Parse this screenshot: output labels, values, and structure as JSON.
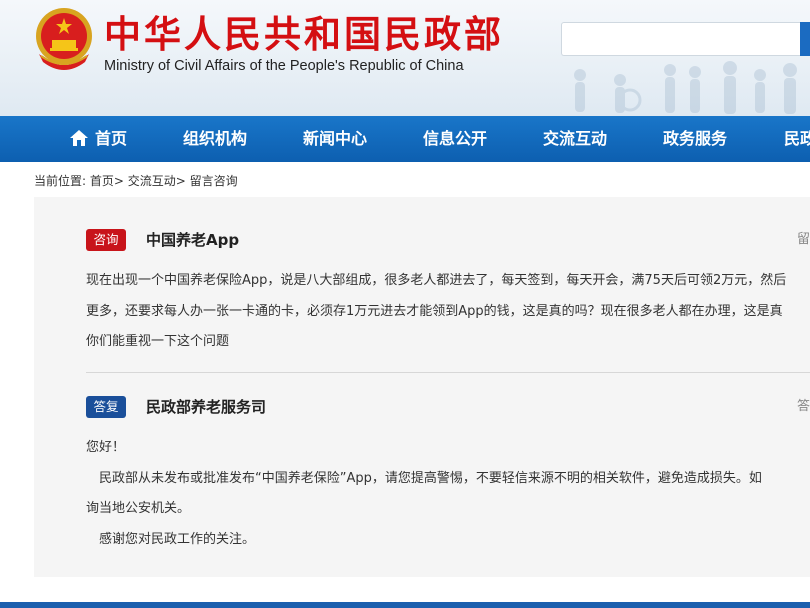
{
  "header": {
    "title_cn": "中华人民共和国民政部",
    "title_en": "Ministry of Civil Affairs of the People's Republic of China",
    "search_placeholder": ""
  },
  "nav": {
    "items": [
      {
        "label": "首页",
        "icon": "home-icon"
      },
      {
        "label": "组织机构"
      },
      {
        "label": "新闻中心"
      },
      {
        "label": "信息公开"
      },
      {
        "label": "交流互动"
      },
      {
        "label": "政务服务"
      },
      {
        "label": "民政"
      }
    ]
  },
  "breadcrumb": {
    "prefix": "当前位置:",
    "items": [
      "首页>",
      "交流互动>",
      "留言咨询"
    ]
  },
  "question": {
    "tag": "咨询",
    "subject": "中国养老App",
    "side": "留",
    "lines": [
      "现在出现一个中国养老保险App，说是八大部组成，很多老人都进去了，每天签到，每天开会，满75天后可领2万元，然后",
      "更多，还要求每人办一张一卡通的卡，必须存1万元进去才能领到App的钱，这是真的吗？现在很多老人都在办理，这是真",
      "你们能重视一下这个问题"
    ]
  },
  "answer": {
    "tag": "答复",
    "subject": "民政部养老服务司",
    "side": "答",
    "lines": [
      "您好！",
      "　民政部从未发布或批准发布“中国养老保险”App，请您提高警惕，不要轻信来源不明的相关软件，避免造成损失。如",
      "询当地公安机关。",
      "　感谢您对民政工作的关注。"
    ]
  },
  "colors": {
    "brand_red": "#d40f12",
    "nav_blue": "#1976c9",
    "tag_question": "#c8141a",
    "tag_answer": "#1a4f9a"
  }
}
